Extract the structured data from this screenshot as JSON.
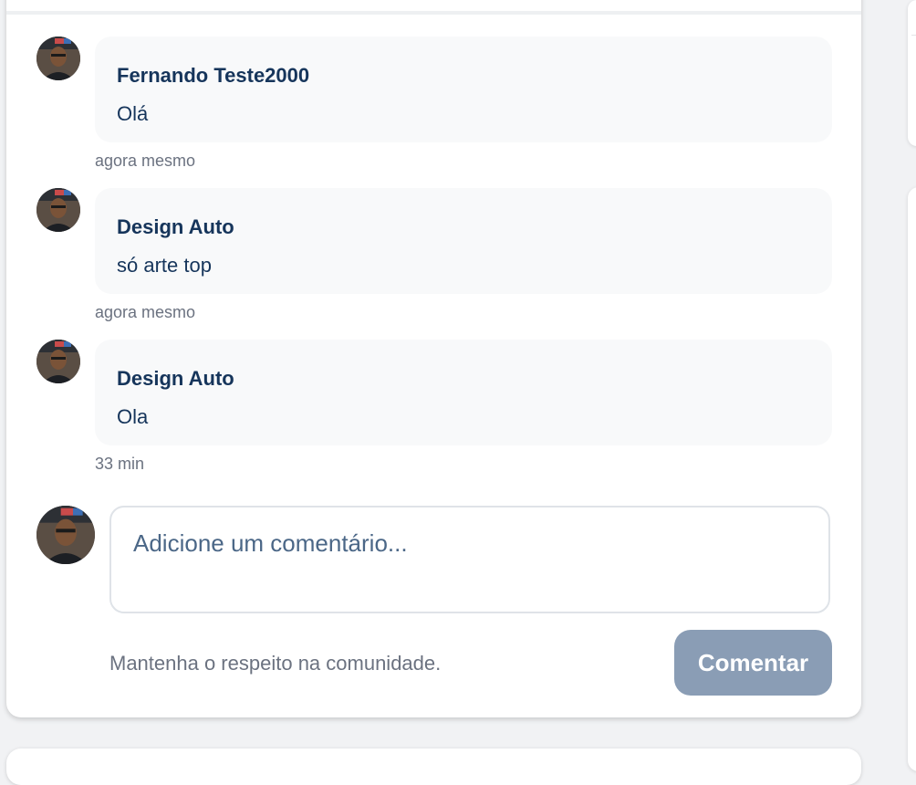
{
  "comments": [
    {
      "author": "Fernando Teste2000",
      "text": "Olá",
      "time": "agora mesmo"
    },
    {
      "author": "Design Auto",
      "text": "só arte top",
      "time": "agora mesmo"
    },
    {
      "author": "Design Auto",
      "text": "Ola",
      "time": "33 min"
    }
  ],
  "composer": {
    "placeholder": "Adicione um comentário...",
    "hint": "Mantenha o respeito na comunidade.",
    "submit_label": "Comentar"
  },
  "colors": {
    "author_text": "#16355b",
    "bubble_bg": "#f8f9fa",
    "button_bg": "#8a9db5",
    "muted_text": "#6b7280"
  },
  "icons": {
    "avatar": "user-avatar-photo"
  }
}
